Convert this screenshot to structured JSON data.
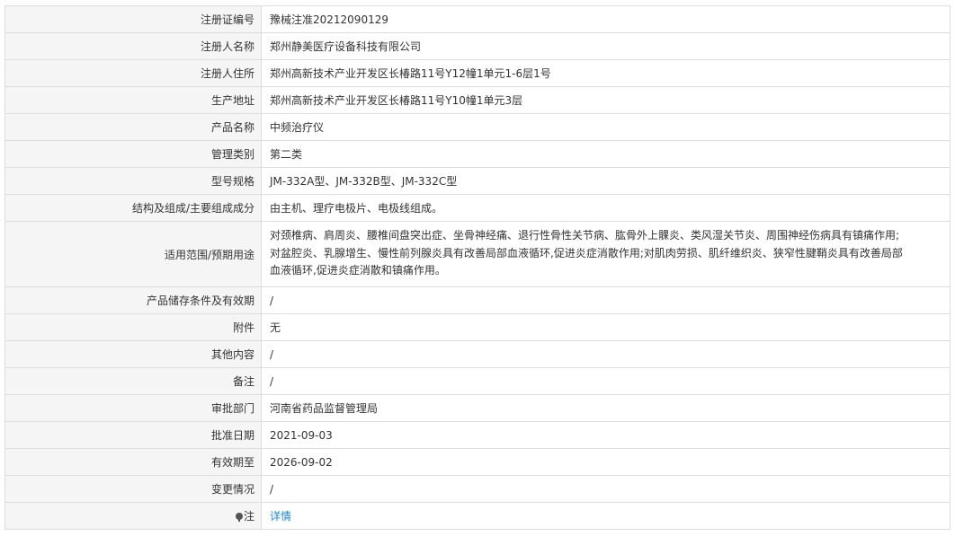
{
  "rows": [
    {
      "label": "注册证编号",
      "value": "豫械注准20212090129"
    },
    {
      "label": "注册人名称",
      "value": "郑州静美医疗设备科技有限公司"
    },
    {
      "label": "注册人住所",
      "value": "郑州高新技术产业开发区长椿路11号Y12幢1单元1-6层1号"
    },
    {
      "label": "生产地址",
      "value": "郑州高新技术产业开发区长椿路11号Y10幢1单元3层"
    },
    {
      "label": "产品名称",
      "value": "中频治疗仪"
    },
    {
      "label": "管理类别",
      "value": "第二类"
    },
    {
      "label": "型号规格",
      "value": "JM-332A型、JM-332B型、JM-332C型"
    },
    {
      "label": "结构及组成/主要组成成分",
      "value": "由主机、理疗电极片、电极线组成。"
    },
    {
      "label": "适用范围/预期用途",
      "value_lines": [
        "对颈椎病、肩周炎、腰椎间盘突出症、坐骨神经痛、退行性骨性关节病、肱骨外上髁炎、类风湿关节炎、周围神经伤病具有镇痛作用;",
        "对盆腔炎、乳腺增生、慢性前列腺炎具有改善局部血液循环,促进炎症消散作用;对肌肉劳损、肌纤维织炎、狭窄性腱鞘炎具有改善局部",
        "血液循环,促进炎症消散和镇痛作用。"
      ]
    },
    {
      "label": "产品储存条件及有效期",
      "value": "/"
    },
    {
      "label": "附件",
      "value": "无"
    },
    {
      "label": "其他内容",
      "value": "/"
    },
    {
      "label": "备注",
      "value": "/"
    },
    {
      "label": "审批部门",
      "value": "河南省药品监督管理局"
    },
    {
      "label": "批准日期",
      "value": "2021-09-03"
    },
    {
      "label": "有效期至",
      "value": "2026-09-02"
    },
    {
      "label": "变更情况",
      "value": "/"
    },
    {
      "label": "注",
      "value": "详情",
      "icon": "note-pin-icon"
    }
  ]
}
